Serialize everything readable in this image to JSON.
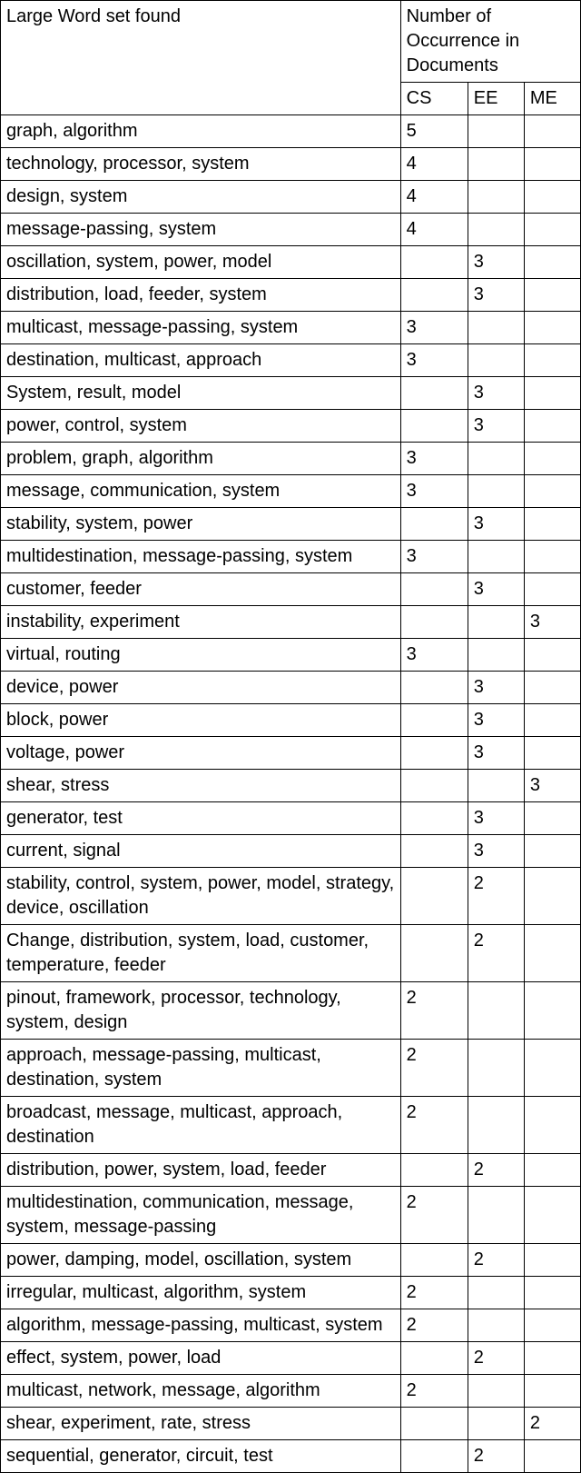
{
  "headers": {
    "wordset": "Large Word set found",
    "occurrence": "Number of Occurrence in Documents",
    "cs": "CS",
    "ee": "EE",
    "me": "ME"
  },
  "rows": [
    {
      "wordset": "graph, algorithm",
      "cs": "5",
      "ee": "",
      "me": ""
    },
    {
      "wordset": "technology, processor, system",
      "cs": "4",
      "ee": "",
      "me": ""
    },
    {
      "wordset": "design, system",
      "cs": "4",
      "ee": "",
      "me": ""
    },
    {
      "wordset": "message-passing, system",
      "cs": "4",
      "ee": "",
      "me": ""
    },
    {
      "wordset": "oscillation, system, power, model",
      "cs": "",
      "ee": "3",
      "me": ""
    },
    {
      "wordset": "distribution, load, feeder, system",
      "cs": "",
      "ee": "3",
      "me": ""
    },
    {
      "wordset": "multicast, message-passing, system",
      "cs": "3",
      "ee": "",
      "me": ""
    },
    {
      "wordset": "destination, multicast, approach",
      "cs": "3",
      "ee": "",
      "me": ""
    },
    {
      "wordset": "System, result, model",
      "cs": "",
      "ee": "3",
      "me": ""
    },
    {
      "wordset": "power, control, system",
      "cs": "",
      "ee": "3",
      "me": ""
    },
    {
      "wordset": "problem, graph, algorithm",
      "cs": "3",
      "ee": "",
      "me": ""
    },
    {
      "wordset": "message, communication, system",
      "cs": "3",
      "ee": "",
      "me": ""
    },
    {
      "wordset": "stability, system, power",
      "cs": "",
      "ee": "3",
      "me": ""
    },
    {
      "wordset": "multidestination, message-passing, system",
      "cs": "3",
      "ee": "",
      "me": ""
    },
    {
      "wordset": "customer, feeder",
      "cs": "",
      "ee": "3",
      "me": ""
    },
    {
      "wordset": "instability, experiment",
      "cs": "",
      "ee": "",
      "me": "3"
    },
    {
      "wordset": "virtual, routing",
      "cs": "3",
      "ee": "",
      "me": ""
    },
    {
      "wordset": "device, power",
      "cs": "",
      "ee": "3",
      "me": ""
    },
    {
      "wordset": "block, power",
      "cs": "",
      "ee": "3",
      "me": ""
    },
    {
      "wordset": "voltage, power",
      "cs": "",
      "ee": "3",
      "me": ""
    },
    {
      "wordset": "shear, stress",
      "cs": "",
      "ee": "",
      "me": "3"
    },
    {
      "wordset": "generator, test",
      "cs": "",
      "ee": "3",
      "me": ""
    },
    {
      "wordset": "current, signal",
      "cs": "",
      "ee": "3",
      "me": ""
    },
    {
      "wordset": "stability, control, system, power, model, strategy, device, oscillation",
      "cs": "",
      "ee": "2",
      "me": ""
    },
    {
      "wordset": "Change, distribution, system, load, customer, temperature, feeder",
      "cs": "",
      "ee": "2",
      "me": ""
    },
    {
      "wordset": "pinout, framework, processor, technology, system, design",
      "cs": "2",
      "ee": "",
      "me": ""
    },
    {
      "wordset": "approach, message-passing, multicast, destination, system",
      "cs": "2",
      "ee": "",
      "me": ""
    },
    {
      "wordset": "broadcast, message, multicast, approach, destination",
      "cs": "2",
      "ee": "",
      "me": ""
    },
    {
      "wordset": "distribution, power, system, load, feeder",
      "cs": "",
      "ee": "2",
      "me": ""
    },
    {
      "wordset": "multidestination, communication, message, system, message-passing",
      "cs": "2",
      "ee": "",
      "me": ""
    },
    {
      "wordset": "power, damping, model, oscillation, system",
      "cs": "",
      "ee": "2",
      "me": ""
    },
    {
      "wordset": "irregular, multicast, algorithm, system",
      "cs": "2",
      "ee": "",
      "me": ""
    },
    {
      "wordset": "algorithm, message-passing, multicast, system",
      "cs": "2",
      "ee": "",
      "me": ""
    },
    {
      "wordset": "effect, system, power, load",
      "cs": "",
      "ee": "2",
      "me": ""
    },
    {
      "wordset": "multicast, network, message, algorithm",
      "cs": "2",
      "ee": "",
      "me": ""
    },
    {
      "wordset": "shear, experiment, rate, stress",
      "cs": "",
      "ee": "",
      "me": "2"
    },
    {
      "wordset": "sequential, generator, circuit, test",
      "cs": "",
      "ee": "2",
      "me": ""
    }
  ]
}
